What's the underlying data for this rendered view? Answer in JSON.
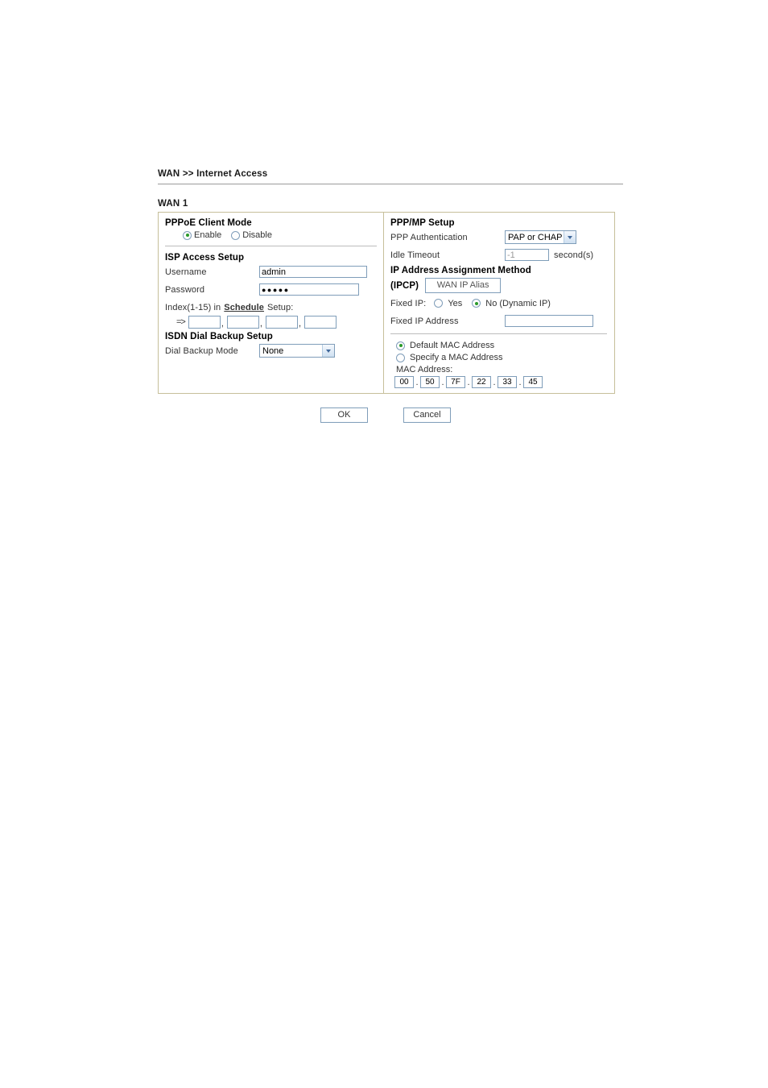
{
  "breadcrumb": {
    "root": "WAN",
    "separator": ">>",
    "leaf": "Internet Access"
  },
  "wan_label": "WAN 1",
  "left_panel": {
    "pppoe_mode": {
      "title": "PPPoE Client Mode",
      "options": [
        {
          "label": "Enable",
          "selected": true
        },
        {
          "label": "Disable",
          "selected": false
        }
      ]
    },
    "isp_access": {
      "title": "ISP Access Setup",
      "username_label": "Username",
      "username_value": "admin",
      "password_label": "Password",
      "password_value": "●●●●●",
      "schedule_prefix": "Index(1-15) in",
      "schedule_link": "Schedule",
      "schedule_suffix": "Setup:",
      "schedule_arrow": "=>",
      "schedule_values": [
        "",
        "",
        "",
        ""
      ],
      "schedule_separator": ","
    },
    "isdn_backup": {
      "title": "ISDN Dial Backup Setup",
      "mode_label": "Dial Backup Mode",
      "mode_value": "None"
    }
  },
  "right_panel": {
    "ppp_mp": {
      "title": "PPP/MP Setup",
      "auth_label": "PPP Authentication",
      "auth_value": "PAP or CHAP",
      "idle_label": "Idle Timeout",
      "idle_value": "-1",
      "idle_unit": "second(s)"
    },
    "ip_assignment": {
      "title": "IP Address Assignment Method",
      "subtitle": "(IPCP)",
      "alias_button": "WAN IP Alias",
      "fixed_ip_label": "Fixed IP:",
      "fixed_ip_options": [
        {
          "label": "Yes",
          "selected": false
        },
        {
          "label": "No (Dynamic IP)",
          "selected": true
        }
      ],
      "fixed_ip_address_label": "Fixed IP Address",
      "fixed_ip_address_value": ""
    },
    "mac": {
      "options": [
        {
          "label": "Default MAC Address",
          "selected": true
        },
        {
          "label": "Specify a MAC Address",
          "selected": false
        }
      ],
      "address_label": "MAC Address:",
      "octets": [
        "00",
        "50",
        "7F",
        "22",
        "33",
        "45"
      ],
      "octet_separator": "."
    }
  },
  "footer": {
    "ok_label": "OK",
    "cancel_label": "Cancel"
  },
  "colors": {
    "panel_border": "#c6bf9a",
    "input_border": "#7f9db9",
    "radio_dot": "#2a9a2a",
    "divider": "#bcbcbc"
  }
}
